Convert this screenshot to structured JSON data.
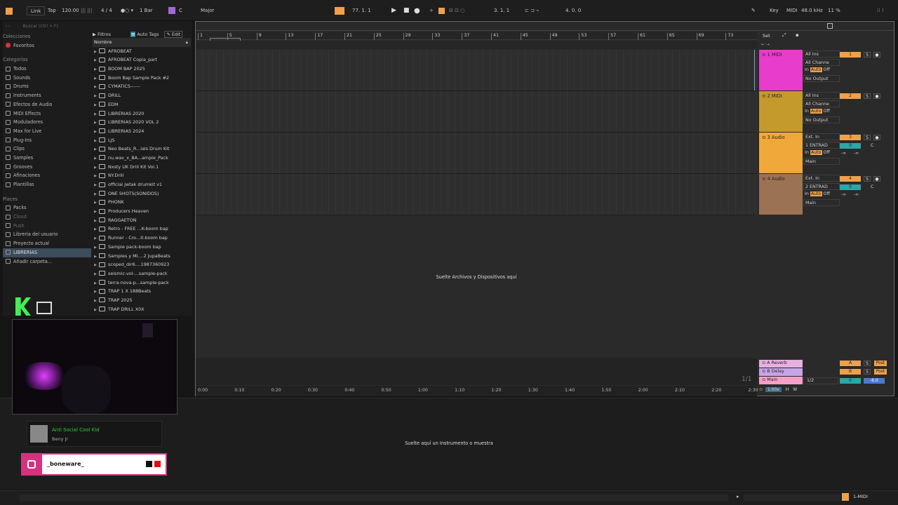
{
  "topbar": {
    "link": "Link",
    "tap": "Tap",
    "tempo": "120.00",
    "signature": "4 / 4",
    "quantize": "1 Bar",
    "key": "C",
    "scale": "Major",
    "position": "77.   1.   1",
    "loop_start": "3.   1.   1",
    "loop_length": "4.   0.   0",
    "key_label": "Key",
    "midi_label": "MIDI",
    "sample_rate": "48.0 kHz",
    "cpu": "11 %"
  },
  "browser": {
    "search_placeholder": "Buscar (Ctrl + F)",
    "filters_label": "Filtros",
    "autotags_label": "Auto Tags",
    "edit_label": "Edit",
    "name_header": "Nombre",
    "collections_header": "Colecciones",
    "favorites": "Favoritos",
    "categories_header": "Categorías",
    "categories": [
      "Todos",
      "Sounds",
      "Drums",
      "Instruments",
      "Efectos de Audio",
      "MIDI Effects",
      "Moduladores",
      "Max for Live",
      "Plug-Ins",
      "Clips",
      "Samples",
      "Grooves",
      "Afinaciones",
      "Plantillas"
    ],
    "places_header": "Places",
    "places": [
      "Packs",
      "Cloud",
      "Push",
      "Librería del usuario",
      "Proyecto actual",
      "LIBRERIAS",
      "Añadir carpeta..."
    ],
    "folders": [
      "AFROBEAT",
      "AFROBEAT Copia_part",
      "BOOM BAP 2025",
      "Boom Bap Sample Pack #2",
      "CYMATICS------",
      "DRILL",
      "EDM",
      "LIBRERIAS 2020",
      "LIBRERIAS 2020 VOL 2",
      "LIBRERIAS 2024",
      "LJS",
      "Neo Beats_R...ials Drum Kit",
      "nu.wav_x_BA...ample_Pack",
      "Nxsty UK Drill Kit Vol.1",
      "NY.Drill",
      "official jwtak drumkit v1",
      "ONE SHOTS(SONIDOS)",
      "PHONK",
      "Producers Heaven",
      "RAGGAETON",
      "Retro - FREE ...K-boom bap",
      "Runner - Cro...it-boom bap",
      "Sample pack-boom bap",
      "Samples y MI....2 JupaBeats",
      "scoped_dir6....1987360923",
      "seismic-vol-...sample-pack",
      "terra-nova-p...sample-pack",
      "TRAP 1 X 188Beats",
      "TRAP 2025",
      "TRAP DRILL X0X"
    ]
  },
  "ruler": {
    "bars": [
      "1",
      "5",
      "9",
      "13",
      "17",
      "21",
      "25",
      "29",
      "33",
      "37",
      "41",
      "45",
      "49",
      "53",
      "57",
      "61",
      "65",
      "69",
      "73"
    ]
  },
  "arrangement": {
    "drop_hint": "Suelte Archivos y Dispositivos aquí",
    "set_label": "Set",
    "zoom": "1/1",
    "speed": "1.00x",
    "h": "H",
    "w": "W"
  },
  "timeline": [
    "0:00",
    "0:10",
    "0:20",
    "0:30",
    "0:40",
    "0:50",
    "1:00",
    "1:10",
    "1:20",
    "1:30",
    "1:40",
    "1:50",
    "2:00",
    "2:10",
    "2:20",
    "2:30"
  ],
  "tracks": [
    {
      "name": "1 MIDI",
      "color": "#e83ccc",
      "input": "All Ins",
      "channel": "All Channe",
      "monitor": [
        "In",
        "Auto",
        "Off"
      ],
      "output": "No Output",
      "num": "1"
    },
    {
      "name": "2 MIDI",
      "color": "#c49a2c",
      "input": "All Ins",
      "channel": "All Channe",
      "monitor": [
        "In",
        "Auto",
        "Off"
      ],
      "output": "No Output",
      "num": "2"
    },
    {
      "name": "3 Audio",
      "color": "#f0a83a",
      "input": "Ext. In",
      "channel": "1 ENTRAD",
      "monitor": [
        "In",
        "Auto",
        "Off"
      ],
      "output": "Main",
      "num": "3",
      "vol": "0",
      "pan": "C",
      "inf1": "-∞",
      "inf2": "-∞"
    },
    {
      "name": "4 Audio",
      "color": "#9c7254",
      "input": "Ext. In",
      "channel": "2 ENTRAD",
      "monitor": [
        "In",
        "Auto",
        "Off"
      ],
      "output": "Main",
      "num": "4",
      "vol": "0",
      "pan": "C",
      "inf1": "-∞",
      "inf2": "-∞"
    }
  ],
  "returns": [
    {
      "name": "A Reverb",
      "letter": "A",
      "post": "Post"
    },
    {
      "name": "B Delay",
      "letter": "B",
      "post": "Post"
    }
  ],
  "main": {
    "name": "Main",
    "out": "1/2",
    "vol": "0",
    "db": "-6.0"
  },
  "detail": {
    "hint": "Suelte aquí un Instrumento o muestra"
  },
  "status": {
    "track": "1-MIDI"
  },
  "overlay": {
    "song_title": "Anti Social Cool Kid",
    "artist": "Beny Jr",
    "instagram": "_boneware_"
  }
}
